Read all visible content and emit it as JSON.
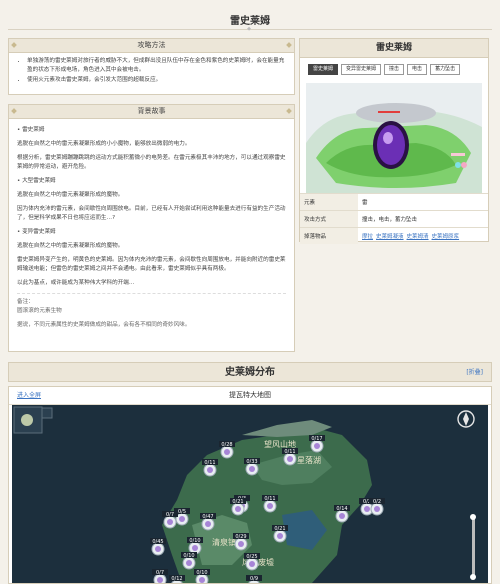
{
  "page": {
    "title": "雷史莱姆"
  },
  "strategy": {
    "title": "攻略方法",
    "items": [
      "单独游荡的雷史莱姆对旅行者的威胁不大，但成群出没且队伍中存在金色和紫色的史莱姆时，会在能量充盈的状态下形成电场，角色进入其中会被电击。",
      "使用火元素攻击雷史莱姆，会引发大范围的超载反应。"
    ]
  },
  "story": {
    "title": "背景故事",
    "paragraphs": [
      {
        "type": "heading",
        "text": "雷史莱姆"
      },
      {
        "type": "text",
        "text": "逃脱在自然之中的雷元素凝聚形成的小小魔物，能够放出微弱的电力。"
      },
      {
        "type": "text",
        "text": "根据分析，雷史莱姆蹦蹦跳跳的运动方式能积蓄微小的电势差。在雷元素极其丰沛的地方，可以通过观察雷史莱姆的异常运动，避开危险。"
      },
      {
        "type": "heading",
        "text": "大型雷史莱姆"
      },
      {
        "type": "text",
        "text": "逃脱在自然之中的雷元素凝聚形成的魔物。"
      },
      {
        "type": "text",
        "text": "因为体内充沛的雷元素，会间歇性向周围放电。目前，已经有人开始尝试利用这种能量去进行有益的生产活动了，但是科学成果不日也将应运而生…?"
      },
      {
        "type": "heading",
        "text": "变异雷史莱姆"
      },
      {
        "type": "text",
        "text": "逃脱在自然之中的雷元素凝聚形成的魔物。"
      },
      {
        "type": "text",
        "text": "雷史莱姆异变产生的，明黄色的史莱姆。因为体内充沛的雷元素，会间歇性向周围放电，并能向附近的雷史莱姆输送电能；但雷色的雷史莱姆之间并不会通电。由此看来，雷史莱姆似乎具有两极。"
      },
      {
        "type": "text",
        "text": "以此为基点，或许能成为某种伟大学科的开端…"
      }
    ],
    "note_label": "备注：",
    "note_lines": [
      "圆滚滚的元素生物",
      "据说，不同元素属性的史莱姆做成的甜品，会有各不相同的奇妙风味。"
    ]
  },
  "info": {
    "title": "雷史莱姆",
    "tabs": [
      "雷史莱姆",
      "变异雷史莱姆",
      "撞击",
      "电击",
      "蓄力坠击"
    ],
    "active_tab": 0,
    "rows": [
      {
        "key": "元素",
        "value": "雷"
      },
      {
        "key": "攻击方式",
        "value": "撞击，电击，蓄力坠击"
      }
    ],
    "drops_label": "掉落物品",
    "drops": [
      "摩拉",
      "史莱姆凝液",
      "史莱姆清",
      "史莱姆原浆"
    ]
  },
  "distribution": {
    "title": "史莱姆分布",
    "collapse_label": "[折叠]",
    "fullscreen_label": "进入全屏",
    "map_title": "提瓦特大地图",
    "places": [
      "望风山地",
      "星落湖",
      "清泉镇",
      "风龙废墟"
    ],
    "markers": [
      {
        "label": "0/28"
      },
      {
        "label": "0/17"
      },
      {
        "label": "0/11"
      },
      {
        "label": "0/2"
      },
      {
        "label": "0/33"
      },
      {
        "label": "0/5"
      },
      {
        "label": "0/11"
      },
      {
        "label": "0/3"
      },
      {
        "label": "0/7"
      },
      {
        "label": "0/47"
      },
      {
        "label": "0/21"
      },
      {
        "label": "0/11"
      },
      {
        "label": "0/14"
      },
      {
        "label": "0/2"
      },
      {
        "label": "0/29"
      },
      {
        "label": "0/10"
      },
      {
        "label": "0/45"
      },
      {
        "label": "0/10"
      },
      {
        "label": "0/25"
      },
      {
        "label": "0/7"
      },
      {
        "label": "0/10"
      },
      {
        "label": "0/21"
      },
      {
        "label": "0/12"
      },
      {
        "label": "0/9"
      }
    ]
  },
  "colors": {
    "accent": "#3b74c2",
    "panel_head": "#ece6d8",
    "map_sea": "#1c2f3d",
    "map_land": "#3c6b4c"
  }
}
